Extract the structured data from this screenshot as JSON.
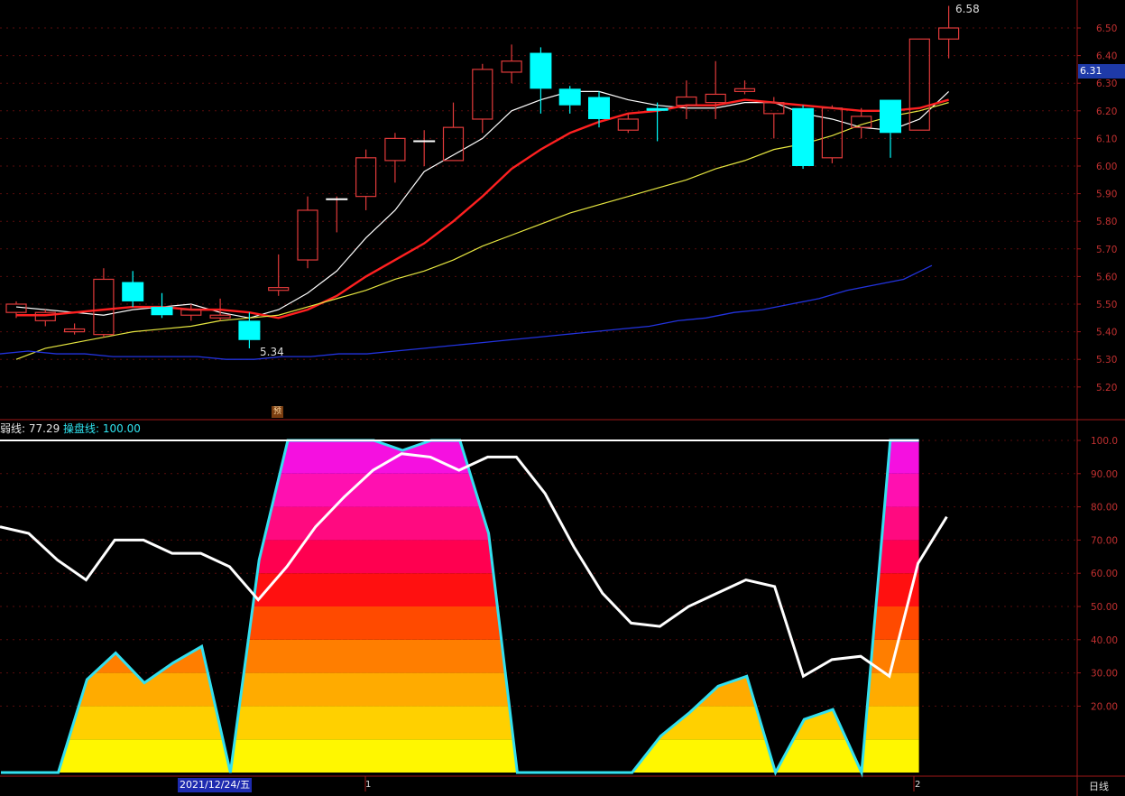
{
  "indicator": {
    "name": "弱线: 77.29",
    "name2": "操盘线: 100.00"
  },
  "current_price": "6.31",
  "date_label": "2021/12/24/五",
  "cycle": "日线",
  "period_markers": [
    "1",
    "2"
  ],
  "pre_badge": "预",
  "colors": {
    "up": "#e03a3a",
    "down": "#00ffff",
    "ma5": "#ffffff",
    "ma10": "#ff2020",
    "ma20": "#e6e640",
    "ma60": "#2233dd",
    "axis": "#a01818",
    "ind_edge": "#33e0f0"
  },
  "chart_data": [
    {
      "type": "candlestick",
      "title": "",
      "ylim": [
        5.13,
        6.62
      ],
      "y_ticks": [
        "5.20",
        "5.30",
        "5.40",
        "5.50",
        "5.60",
        "5.70",
        "5.80",
        "5.90",
        "6.00",
        "6.10",
        "6.20",
        "6.30",
        "6.40",
        "6.50"
      ],
      "annotations": {
        "high": "6.58",
        "low": "5.34"
      },
      "candles": [
        {
          "o": 5.47,
          "c": 5.5,
          "h": 5.51,
          "l": 5.45
        },
        {
          "o": 5.44,
          "c": 5.47,
          "h": 5.48,
          "l": 5.42
        },
        {
          "o": 5.4,
          "c": 5.41,
          "h": 5.43,
          "l": 5.39
        },
        {
          "o": 5.39,
          "c": 5.59,
          "h": 5.63,
          "l": 5.38
        },
        {
          "o": 5.58,
          "c": 5.51,
          "h": 5.62,
          "l": 5.49
        },
        {
          "o": 5.49,
          "c": 5.46,
          "h": 5.54,
          "l": 5.45
        },
        {
          "o": 5.46,
          "c": 5.48,
          "h": 5.5,
          "l": 5.44
        },
        {
          "o": 5.45,
          "c": 5.46,
          "h": 5.52,
          "l": 5.44
        },
        {
          "o": 5.44,
          "c": 5.37,
          "h": 5.47,
          "l": 5.34
        },
        {
          "o": 5.55,
          "c": 5.56,
          "h": 5.68,
          "l": 5.53
        },
        {
          "o": 5.66,
          "c": 5.84,
          "h": 5.89,
          "l": 5.63
        },
        {
          "o": 5.88,
          "c": 5.88,
          "h": 5.89,
          "l": 5.76
        },
        {
          "o": 5.89,
          "c": 6.03,
          "h": 6.06,
          "l": 5.84
        },
        {
          "o": 6.02,
          "c": 6.1,
          "h": 6.12,
          "l": 5.94
        },
        {
          "o": 6.09,
          "c": 6.09,
          "h": 6.13,
          "l": 6.0
        },
        {
          "o": 6.02,
          "c": 6.14,
          "h": 6.23,
          "l": 6.02
        },
        {
          "o": 6.17,
          "c": 6.35,
          "h": 6.37,
          "l": 6.12
        },
        {
          "o": 6.34,
          "c": 6.38,
          "h": 6.44,
          "l": 6.3
        },
        {
          "o": 6.41,
          "c": 6.28,
          "h": 6.43,
          "l": 6.19
        },
        {
          "o": 6.28,
          "c": 6.22,
          "h": 6.29,
          "l": 6.19
        },
        {
          "o": 6.25,
          "c": 6.17,
          "h": 6.27,
          "l": 6.14
        },
        {
          "o": 6.13,
          "c": 6.17,
          "h": 6.19,
          "l": 6.12
        },
        {
          "o": 6.21,
          "c": 6.2,
          "h": 6.23,
          "l": 6.09
        },
        {
          "o": 6.22,
          "c": 6.25,
          "h": 6.31,
          "l": 6.17
        },
        {
          "o": 6.23,
          "c": 6.26,
          "h": 6.38,
          "l": 6.17
        },
        {
          "o": 6.27,
          "c": 6.28,
          "h": 6.31,
          "l": 6.26
        },
        {
          "o": 6.19,
          "c": 6.23,
          "h": 6.25,
          "l": 6.1
        },
        {
          "o": 6.21,
          "c": 6.0,
          "h": 6.22,
          "l": 5.99
        },
        {
          "o": 6.03,
          "c": 6.21,
          "h": 6.22,
          "l": 6.01
        },
        {
          "o": 6.14,
          "c": 6.18,
          "h": 6.21,
          "l": 6.1
        },
        {
          "o": 6.24,
          "c": 6.12,
          "h": 6.24,
          "l": 6.03
        },
        {
          "o": 6.13,
          "c": 6.46,
          "h": 6.46,
          "l": 6.13
        },
        {
          "o": 6.46,
          "c": 6.5,
          "h": 6.58,
          "l": 6.39
        }
      ],
      "series": [
        {
          "name": "",
          "type": "ma5",
          "values": [
            5.49,
            5.48,
            5.47,
            5.46,
            5.48,
            5.49,
            5.5,
            5.47,
            5.45,
            5.48,
            5.54,
            5.62,
            5.74,
            5.84,
            5.98,
            6.04,
            6.1,
            6.2,
            6.24,
            6.27,
            6.27,
            6.24,
            6.22,
            6.21,
            6.21,
            6.23,
            6.23,
            6.19,
            6.17,
            6.14,
            6.13,
            6.17,
            6.27
          ]
        },
        {
          "name": "",
          "type": "ma10",
          "values": [
            5.46,
            5.46,
            5.47,
            5.48,
            5.49,
            5.49,
            5.48,
            5.48,
            5.47,
            5.45,
            5.48,
            5.53,
            5.6,
            5.66,
            5.72,
            5.8,
            5.89,
            5.99,
            6.06,
            6.12,
            6.16,
            6.19,
            6.2,
            6.22,
            6.22,
            6.24,
            6.23,
            6.22,
            6.21,
            6.2,
            6.2,
            6.21,
            6.24
          ]
        },
        {
          "name": "",
          "type": "ma20",
          "values": [
            5.3,
            5.34,
            5.36,
            5.38,
            5.4,
            5.41,
            5.42,
            5.44,
            5.45,
            5.46,
            5.49,
            5.52,
            5.55,
            5.59,
            5.62,
            5.66,
            5.71,
            5.75,
            5.79,
            5.83,
            5.86,
            5.89,
            5.92,
            5.95,
            5.99,
            6.02,
            6.06,
            6.08,
            6.11,
            6.15,
            6.18,
            6.2,
            6.23
          ]
        },
        {
          "name": "",
          "type": "ma60",
          "values": [
            5.32,
            5.33,
            5.32,
            5.32,
            5.31,
            5.31,
            5.31,
            5.31,
            5.3,
            5.3,
            5.31,
            5.31,
            5.32,
            5.32,
            5.33,
            5.34,
            5.35,
            5.36,
            5.37,
            5.38,
            5.39,
            5.4,
            5.41,
            5.42,
            5.44,
            5.45,
            5.47,
            5.48,
            5.5,
            5.52,
            5.55,
            5.57,
            5.59,
            5.64
          ]
        }
      ]
    },
    {
      "type": "area",
      "title": "",
      "ylim": [
        0,
        100
      ],
      "y_ticks": [
        "20.00",
        "30.00",
        "40.00",
        "50.00",
        "60.00",
        "70.00",
        "80.00",
        "90.00",
        "100.0"
      ],
      "series": [
        {
          "name": "操盘线",
          "type": "filled",
          "values": [
            0,
            0,
            0,
            28,
            36,
            27,
            33,
            38,
            0,
            64,
            100,
            100,
            100,
            100,
            97,
            100,
            100,
            72,
            0,
            0,
            0,
            0,
            0,
            11,
            18,
            26,
            29,
            0,
            16,
            19,
            0,
            100,
            100
          ]
        },
        {
          "name": "弱线",
          "type": "line",
          "values": [
            74,
            72,
            64,
            58,
            70,
            70,
            66,
            66,
            62,
            52,
            62,
            74,
            83,
            91,
            96,
            95,
            91,
            95,
            95,
            84,
            68,
            54,
            45,
            44,
            50,
            54,
            58,
            56,
            29,
            34,
            35,
            29,
            63,
            77
          ]
        }
      ]
    }
  ]
}
